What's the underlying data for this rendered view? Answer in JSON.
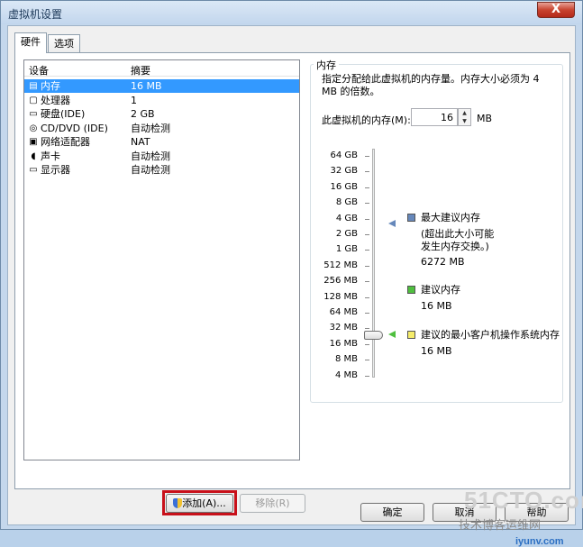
{
  "window": {
    "title": "虚拟机设置",
    "close_label": "X"
  },
  "tabs": [
    {
      "label": "硬件"
    },
    {
      "label": "选项"
    }
  ],
  "device_list": {
    "columns": [
      "设备",
      "摘要"
    ],
    "rows": [
      {
        "icon": "memory-icon",
        "name": "内存",
        "summary": "16 MB",
        "selected": true
      },
      {
        "icon": "processor-icon",
        "name": "处理器",
        "summary": "1"
      },
      {
        "icon": "hard-disk-icon",
        "name": "硬盘(IDE)",
        "summary": "2 GB"
      },
      {
        "icon": "cd-dvd-icon",
        "name": "CD/DVD (IDE)",
        "summary": "自动检测"
      },
      {
        "icon": "network-adapter-icon",
        "name": "网络适配器",
        "summary": "NAT"
      },
      {
        "icon": "sound-card-icon",
        "name": "声卡",
        "summary": "自动检测"
      },
      {
        "icon": "display-icon",
        "name": "显示器",
        "summary": "自动检测"
      }
    ]
  },
  "buttons": {
    "add": "添加(A)...",
    "remove": "移除(R)",
    "ok": "确定",
    "cancel": "取消",
    "help": "帮助"
  },
  "memory": {
    "group_title": "内存",
    "description": "指定分配给此虚拟机的内存量。内存大小必须为 4 MB 的倍数。",
    "vm_memory_label": "此虚拟机的内存(M):",
    "value": "16",
    "unit": "MB",
    "scale_labels": [
      "64 GB",
      "32 GB",
      "16 GB",
      "8 GB",
      "4 GB",
      "2 GB",
      "1 GB",
      "512 MB",
      "256 MB",
      "128 MB",
      "64 MB",
      "32 MB",
      "16 MB",
      "8 MB",
      "4 MB"
    ],
    "max_recommended": {
      "title": "最大建议内存",
      "note": "(超出此大小可能发生内存交换。)",
      "note_line1": "(超出此大小可能",
      "note_line2": "发生内存交换。)",
      "value": "6272 MB",
      "color": "#6688bb"
    },
    "recommended": {
      "title": "建议内存",
      "value": "16 MB",
      "color": "#4fbf3f"
    },
    "guest_min": {
      "title": "建议的最小客户机操作系统内存",
      "value": "16 MB",
      "color": "#f5ec6a"
    }
  },
  "watermark": {
    "line1": "51CTO.com",
    "line2": "技术博客运维网",
    "line3": "iyunv.com"
  }
}
